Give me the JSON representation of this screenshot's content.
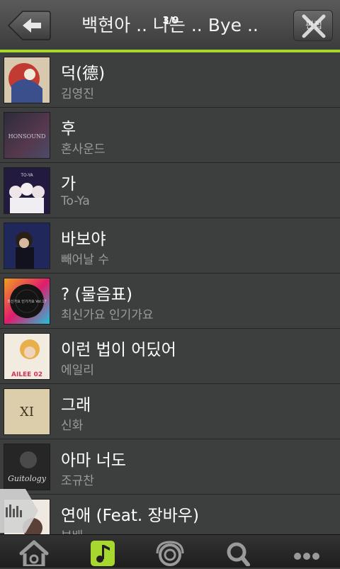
{
  "header": {
    "title": "백현아 .. 나는 .. Bye ..",
    "track_counter": "3/9",
    "edit_label": "편집"
  },
  "songs": [
    {
      "title": "덕(德)",
      "artist": "김영진",
      "cover_art_text": ""
    },
    {
      "title": "후",
      "artist": "혼사운드",
      "cover_art_text": "HONSOUND"
    },
    {
      "title": "가",
      "artist": "To-Ya",
      "cover_art_text": "TO-YA"
    },
    {
      "title": "바보야",
      "artist": "빼어날 수",
      "cover_art_text": ""
    },
    {
      "title": "? (물음표)",
      "artist": "최신가요 인기가요",
      "cover_art_text": "최신가요 인기가요 Vol.17"
    },
    {
      "title": "이런 법이 어딨어",
      "artist": "에일리",
      "cover_art_text": "AILEE 02"
    },
    {
      "title": "그래",
      "artist": "신화",
      "cover_art_text": "XI"
    },
    {
      "title": "아마 너도",
      "artist": "조규찬",
      "cover_art_text": "Guitology"
    },
    {
      "title": "연애 (Feat. 장바우)",
      "artist": "보배",
      "cover_art_text": ""
    }
  ],
  "tabs": [
    {
      "name": "home-icon",
      "active": false
    },
    {
      "name": "music-note-icon",
      "active": true
    },
    {
      "name": "radio-icon",
      "active": false
    },
    {
      "name": "search-icon",
      "active": false
    },
    {
      "name": "more-icon",
      "active": false
    }
  ],
  "colors": {
    "accent": "#a7d82f",
    "background": "#3d3f3f",
    "subtext": "#9b9b9b"
  }
}
